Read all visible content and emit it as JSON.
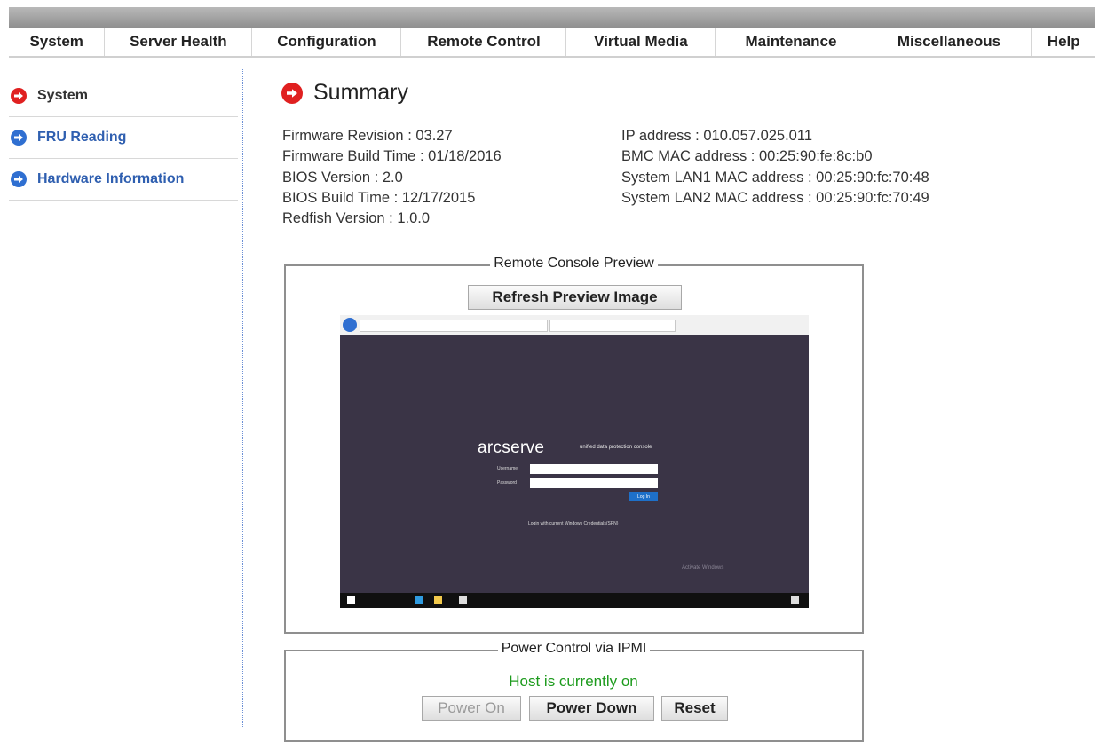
{
  "menu": [
    {
      "label": "System"
    },
    {
      "label": "Server Health"
    },
    {
      "label": "Configuration"
    },
    {
      "label": "Remote Control"
    },
    {
      "label": "Virtual Media"
    },
    {
      "label": "Maintenance"
    },
    {
      "label": "Miscellaneous"
    },
    {
      "label": "Help"
    }
  ],
  "sidebar": {
    "items": [
      {
        "label": "System",
        "icon": "arrow-right-circle-icon",
        "color": "#e02020",
        "active": true
      },
      {
        "label": "FRU Reading",
        "icon": "arrow-right-circle-icon",
        "color": "#2f6fd1",
        "active": false
      },
      {
        "label": "Hardware Information",
        "icon": "arrow-right-circle-icon",
        "color": "#2f6fd1",
        "active": false
      }
    ]
  },
  "summary": {
    "title": "Summary",
    "left": [
      {
        "label": "Firmware Revision",
        "value": "03.27"
      },
      {
        "label": "Firmware Build Time",
        "value": "01/18/2016"
      },
      {
        "label": "BIOS Version",
        "value": "2.0"
      },
      {
        "label": "BIOS Build Time",
        "value": "12/17/2015"
      },
      {
        "label": "Redfish Version",
        "value": "1.0.0"
      }
    ],
    "right": [
      {
        "label": "IP address",
        "value": "010.057.025.011"
      },
      {
        "label": "BMC MAC address",
        "value": "00:25:90:fe:8c:b0"
      },
      {
        "label": "System LAN1 MAC address",
        "value": "00:25:90:fc:70:48"
      },
      {
        "label": "System LAN2 MAC address",
        "value": "00:25:90:fc:70:49"
      }
    ]
  },
  "console": {
    "legend": "Remote Console Preview",
    "refresh_label": "Refresh Preview Image",
    "preview": {
      "logo": "arcserve",
      "logo_sub": "unified data protection console",
      "username_label": "Username",
      "password_label": "Password",
      "login_label": "Log In",
      "link_text": "Login with current Windows Credentials(SPN)",
      "activate_text": "Activate Windows"
    }
  },
  "power": {
    "legend": "Power Control via IPMI",
    "status": "Host is currently on",
    "status_color": "#1d9b1d",
    "power_on_label": "Power On",
    "power_down_label": "Power Down",
    "reset_label": "Reset"
  },
  "colors": {
    "accent_red": "#e02020",
    "accent_blue": "#2f6fd1",
    "topbar": "#9a9a9a"
  }
}
